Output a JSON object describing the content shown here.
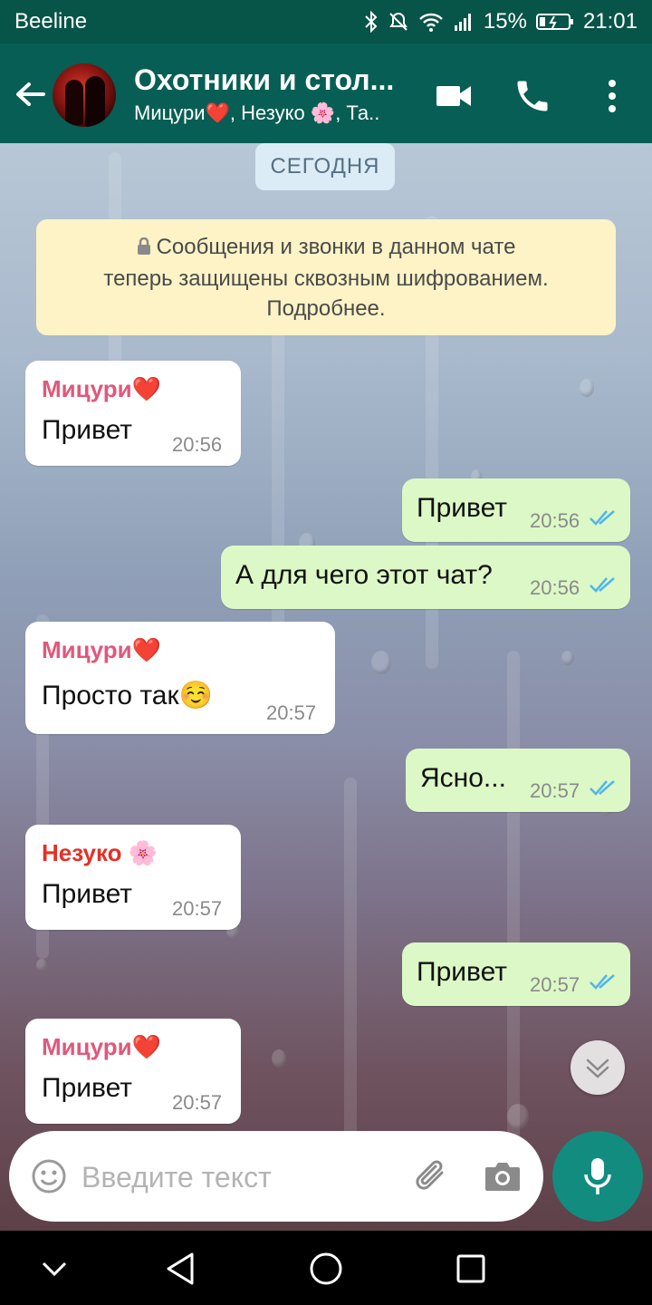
{
  "status_bar": {
    "carrier": "Beeline",
    "battery": "15%",
    "time": "21:01",
    "icons": [
      "bluetooth-icon",
      "mute-icon",
      "wifi-icon",
      "signal-icon",
      "battery-charging-icon"
    ]
  },
  "header": {
    "title": "Охотники и стол...",
    "subtitle": "Мицури❤️, Незуко 🌸, Та..",
    "icons": [
      "back-arrow-icon",
      "video-call-icon",
      "phone-icon",
      "more-vertical-icon"
    ]
  },
  "chat": {
    "date_label": "СЕГОДНЯ",
    "encryption_notice": {
      "line1": "Сообщения и звонки в данном чате",
      "line2": "теперь защищены сквозным шифрованием.",
      "line3": "Подробнее."
    },
    "messages": [
      {
        "direction": "in",
        "sender": "Мицури❤️",
        "sender_color": "#e0587b",
        "text": "Привет",
        "time": "20:56"
      },
      {
        "direction": "out",
        "text": "Привет",
        "time": "20:56",
        "read": true
      },
      {
        "direction": "out",
        "text": "А для чего этот чат?",
        "time": "20:56",
        "read": true
      },
      {
        "direction": "in",
        "sender": "Мицури❤️",
        "sender_color": "#e0587b",
        "text": "Просто так☺️",
        "time": "20:57"
      },
      {
        "direction": "out",
        "text": "Ясно...",
        "time": "20:57",
        "read": true
      },
      {
        "direction": "in",
        "sender": "Незуко 🌸",
        "sender_color": "#e53026",
        "text": "Привет",
        "time": "20:57"
      },
      {
        "direction": "out",
        "text": "Привет",
        "time": "20:57",
        "read": true
      },
      {
        "direction": "in",
        "sender": "Мицури❤️",
        "sender_color": "#e0587b",
        "text": "Привет",
        "time": "20:57"
      }
    ]
  },
  "composer": {
    "placeholder": "Введите текст",
    "icons": [
      "emoji-icon",
      "attach-icon",
      "camera-icon",
      "mic-icon"
    ]
  },
  "colors": {
    "header_bg": "#075e54",
    "status_bg": "#075448",
    "outgoing_bubble": "#dcf8c6",
    "incoming_bubble": "#ffffff",
    "read_ticks": "#4fb6ec",
    "mic_button": "#128c7e"
  }
}
